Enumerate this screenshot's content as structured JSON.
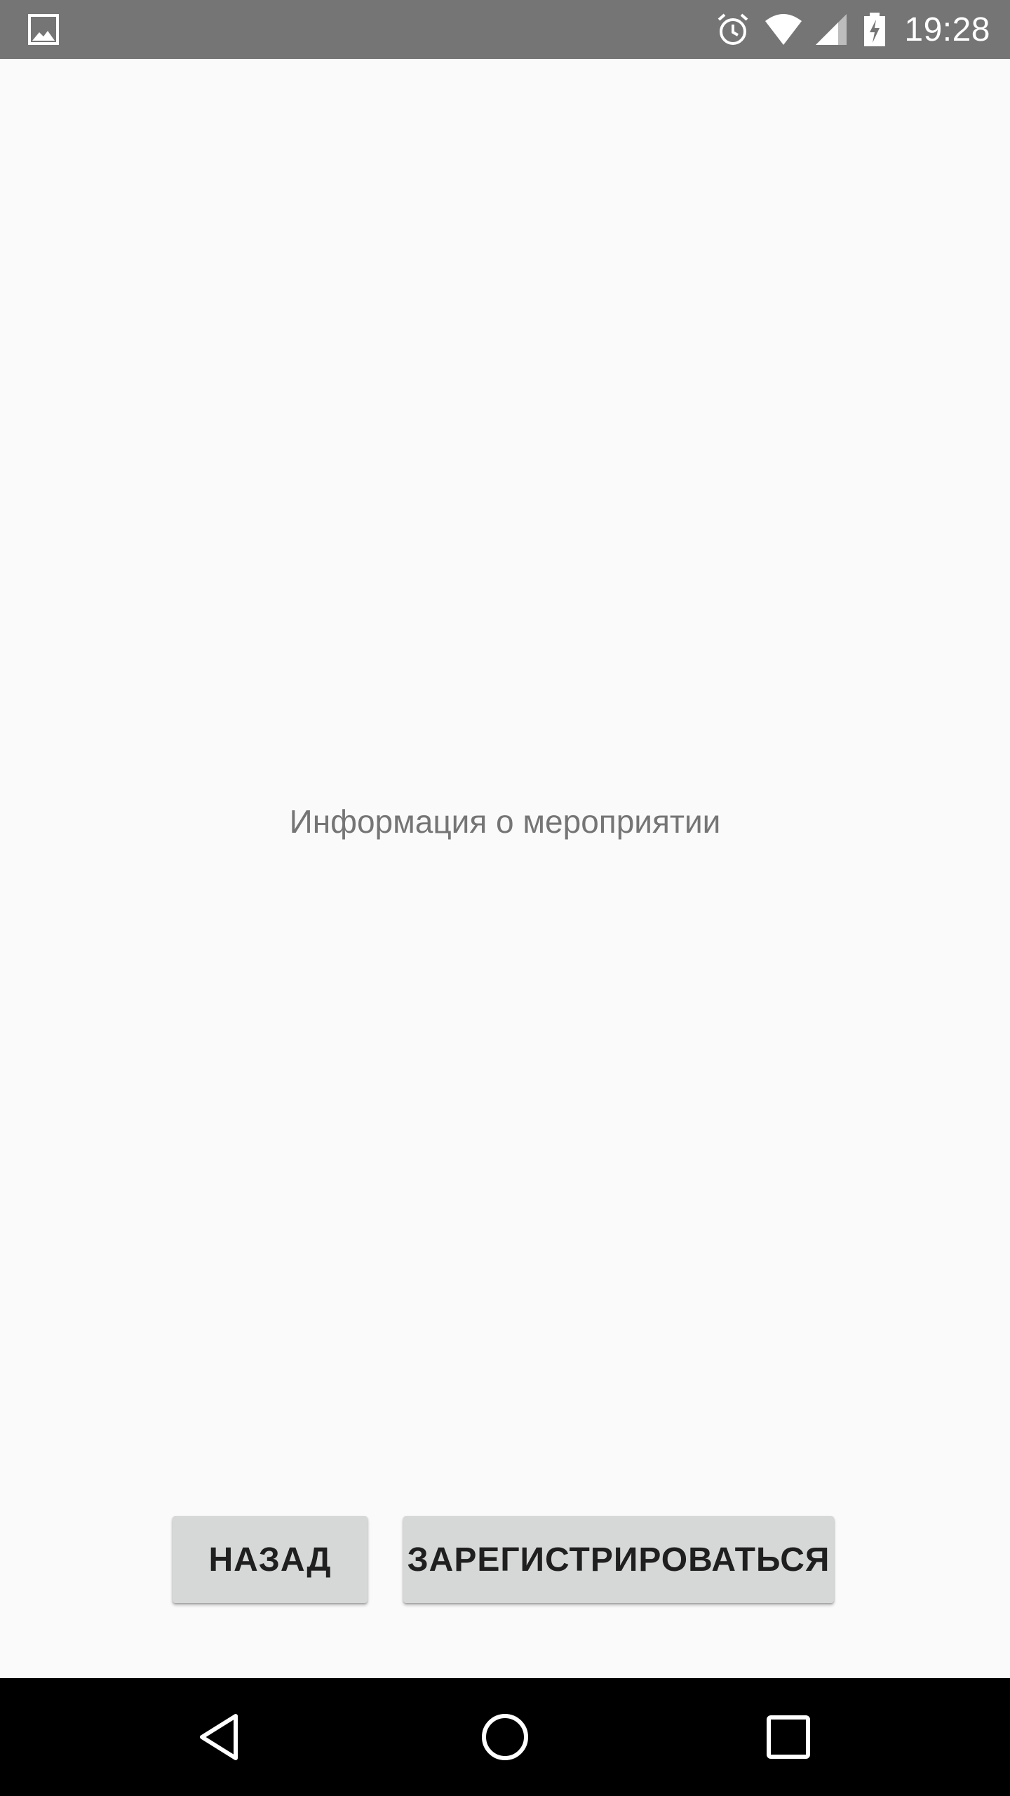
{
  "status_bar": {
    "time": "19:28",
    "icons": [
      "image-notification-icon",
      "alarm-icon",
      "wifi-icon",
      "cellular-signal-icon",
      "battery-charging-icon"
    ],
    "background_color": "#757575"
  },
  "content": {
    "event_info_text": "Информация о мероприятии",
    "background_color": "#fafafa"
  },
  "buttons": {
    "back_label": "НАЗАД",
    "register_label": "ЗАРЕГИСТРИРОВАТЬСЯ",
    "background_color": "#d6d7d7"
  },
  "nav_bar": {
    "icons": [
      "nav-back-icon",
      "nav-home-icon",
      "nav-recent-apps-icon"
    ],
    "background_color": "#000000"
  }
}
